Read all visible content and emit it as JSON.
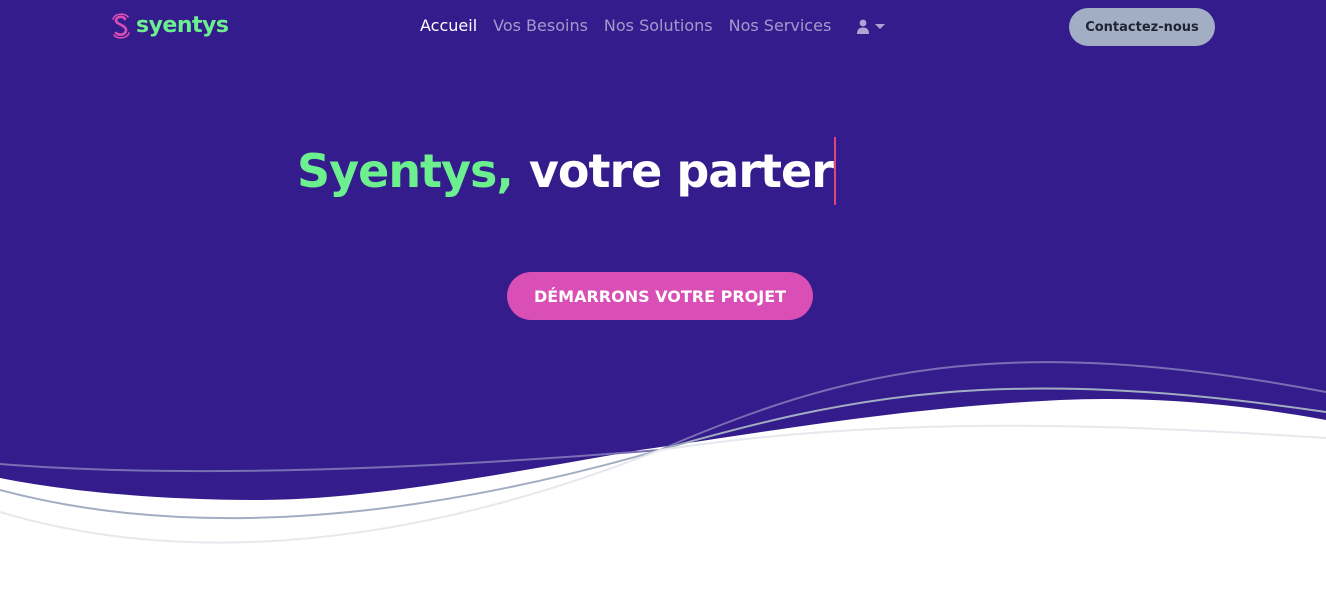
{
  "brand": {
    "name": "syentys",
    "colors": {
      "primary": "#6cf08f",
      "accent": "#d94fb5"
    }
  },
  "nav": {
    "items": [
      {
        "label": "Accueil",
        "active": true
      },
      {
        "label": "Vos Besoins",
        "active": false
      },
      {
        "label": "Nos Solutions",
        "active": false
      },
      {
        "label": "Nos Services",
        "active": false
      }
    ],
    "user_menu_icon": "user-icon",
    "contact_label": "Contactez-nous"
  },
  "hero": {
    "accent_text": "Syentys,",
    "typed_text": "votre parter",
    "cta_label": "DÉMARRONS VOTRE PROJET",
    "background_color": "#341c8c"
  }
}
